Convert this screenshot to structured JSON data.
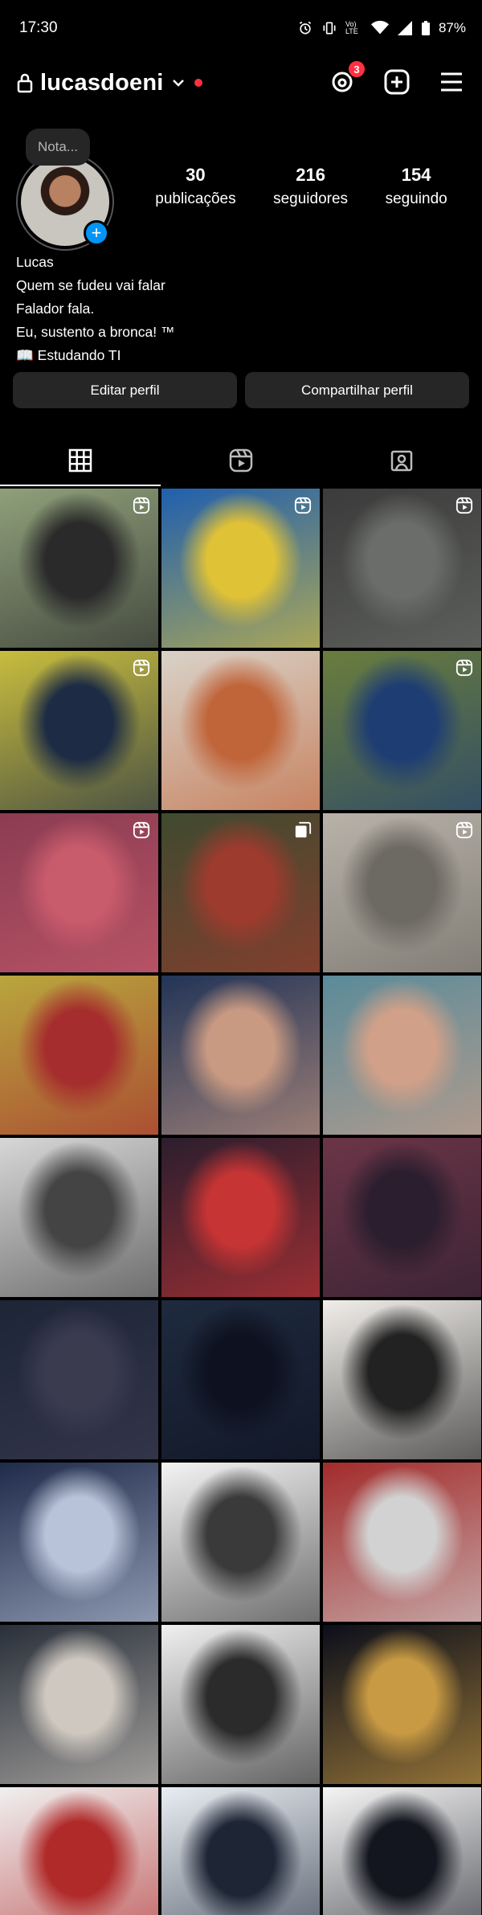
{
  "status_bar": {
    "time": "17:30",
    "battery": "87%",
    "network": "Vo) LTE"
  },
  "header": {
    "username": "lucasdoeni",
    "threads_badge": "3"
  },
  "profile": {
    "note": "Nota...",
    "stats": [
      {
        "value": "30",
        "label": "publicações"
      },
      {
        "value": "216",
        "label": "seguidores"
      },
      {
        "value": "154",
        "label": "seguindo"
      }
    ],
    "name": "Lucas",
    "bio_lines": [
      "Quem se fudeu vai falar",
      "Falador fala.",
      "Eu, sustento a bronca! ™",
      "📖 Estudando TI"
    ]
  },
  "buttons": {
    "edit": "Editar perfil",
    "share": "Compartilhar perfil"
  },
  "tabs": [
    "grid-icon",
    "reels-icon",
    "tagged-icon"
  ],
  "grid": {
    "posts": [
      {
        "type": "reel",
        "colors": [
          "#8fa07a",
          "#2a2a2a"
        ]
      },
      {
        "type": "reel",
        "colors": [
          "#1f5fae",
          "#e0c237"
        ]
      },
      {
        "type": "reel",
        "colors": [
          "#3a3b3a",
          "#6b6d6a"
        ]
      },
      {
        "type": "reel",
        "colors": [
          "#c8bd3e",
          "#1d2b44"
        ]
      },
      {
        "type": "photo",
        "colors": [
          "#d9d2c8",
          "#c0653a"
        ]
      },
      {
        "type": "reel",
        "colors": [
          "#6a7d3d",
          "#1e3d73"
        ]
      },
      {
        "type": "reel",
        "colors": [
          "#8b3c52",
          "#c85b6c"
        ]
      },
      {
        "type": "multi",
        "colors": [
          "#3f4a2f",
          "#9c3b2e"
        ]
      },
      {
        "type": "reel",
        "colors": [
          "#b8b2a9",
          "#6d6a63"
        ]
      },
      {
        "type": "photo",
        "colors": [
          "#b9a63e",
          "#a52d2d"
        ]
      },
      {
        "type": "photo",
        "colors": [
          "#223457",
          "#c99a82"
        ]
      },
      {
        "type": "photo",
        "colors": [
          "#5a8b9a",
          "#d0a088"
        ]
      },
      {
        "type": "photo",
        "colors": [
          "#d7d7d7",
          "#444444"
        ]
      },
      {
        "type": "photo",
        "colors": [
          "#2b1e2e",
          "#c63434"
        ]
      },
      {
        "type": "photo",
        "colors": [
          "#6b3547",
          "#2b1e2e"
        ]
      },
      {
        "type": "photo",
        "colors": [
          "#1d2537",
          "#3b3b50"
        ]
      },
      {
        "type": "photo",
        "colors": [
          "#1e2a3e",
          "#0e1220"
        ]
      },
      {
        "type": "photo",
        "colors": [
          "#f1eeea",
          "#222222"
        ]
      },
      {
        "type": "photo",
        "colors": [
          "#1f2b4a",
          "#b8c2d8"
        ]
      },
      {
        "type": "photo",
        "colors": [
          "#f4f4f4",
          "#3a3a3a"
        ]
      },
      {
        "type": "photo",
        "colors": [
          "#a32b2b",
          "#d2d2d2"
        ]
      },
      {
        "type": "photo",
        "colors": [
          "#29303a",
          "#cfc8c0"
        ]
      },
      {
        "type": "photo",
        "colors": [
          "#f0f0f0",
          "#2b2b2b"
        ]
      },
      {
        "type": "photo",
        "colors": [
          "#0b0e1a",
          "#c89a43"
        ]
      },
      {
        "type": "photo",
        "colors": [
          "#f0f0f0",
          "#b02a2a"
        ]
      },
      {
        "type": "photo",
        "colors": [
          "#e9eef3",
          "#1e2636"
        ]
      },
      {
        "type": "photo",
        "colors": [
          "#f5f5f5",
          "#14161f"
        ]
      }
    ]
  }
}
